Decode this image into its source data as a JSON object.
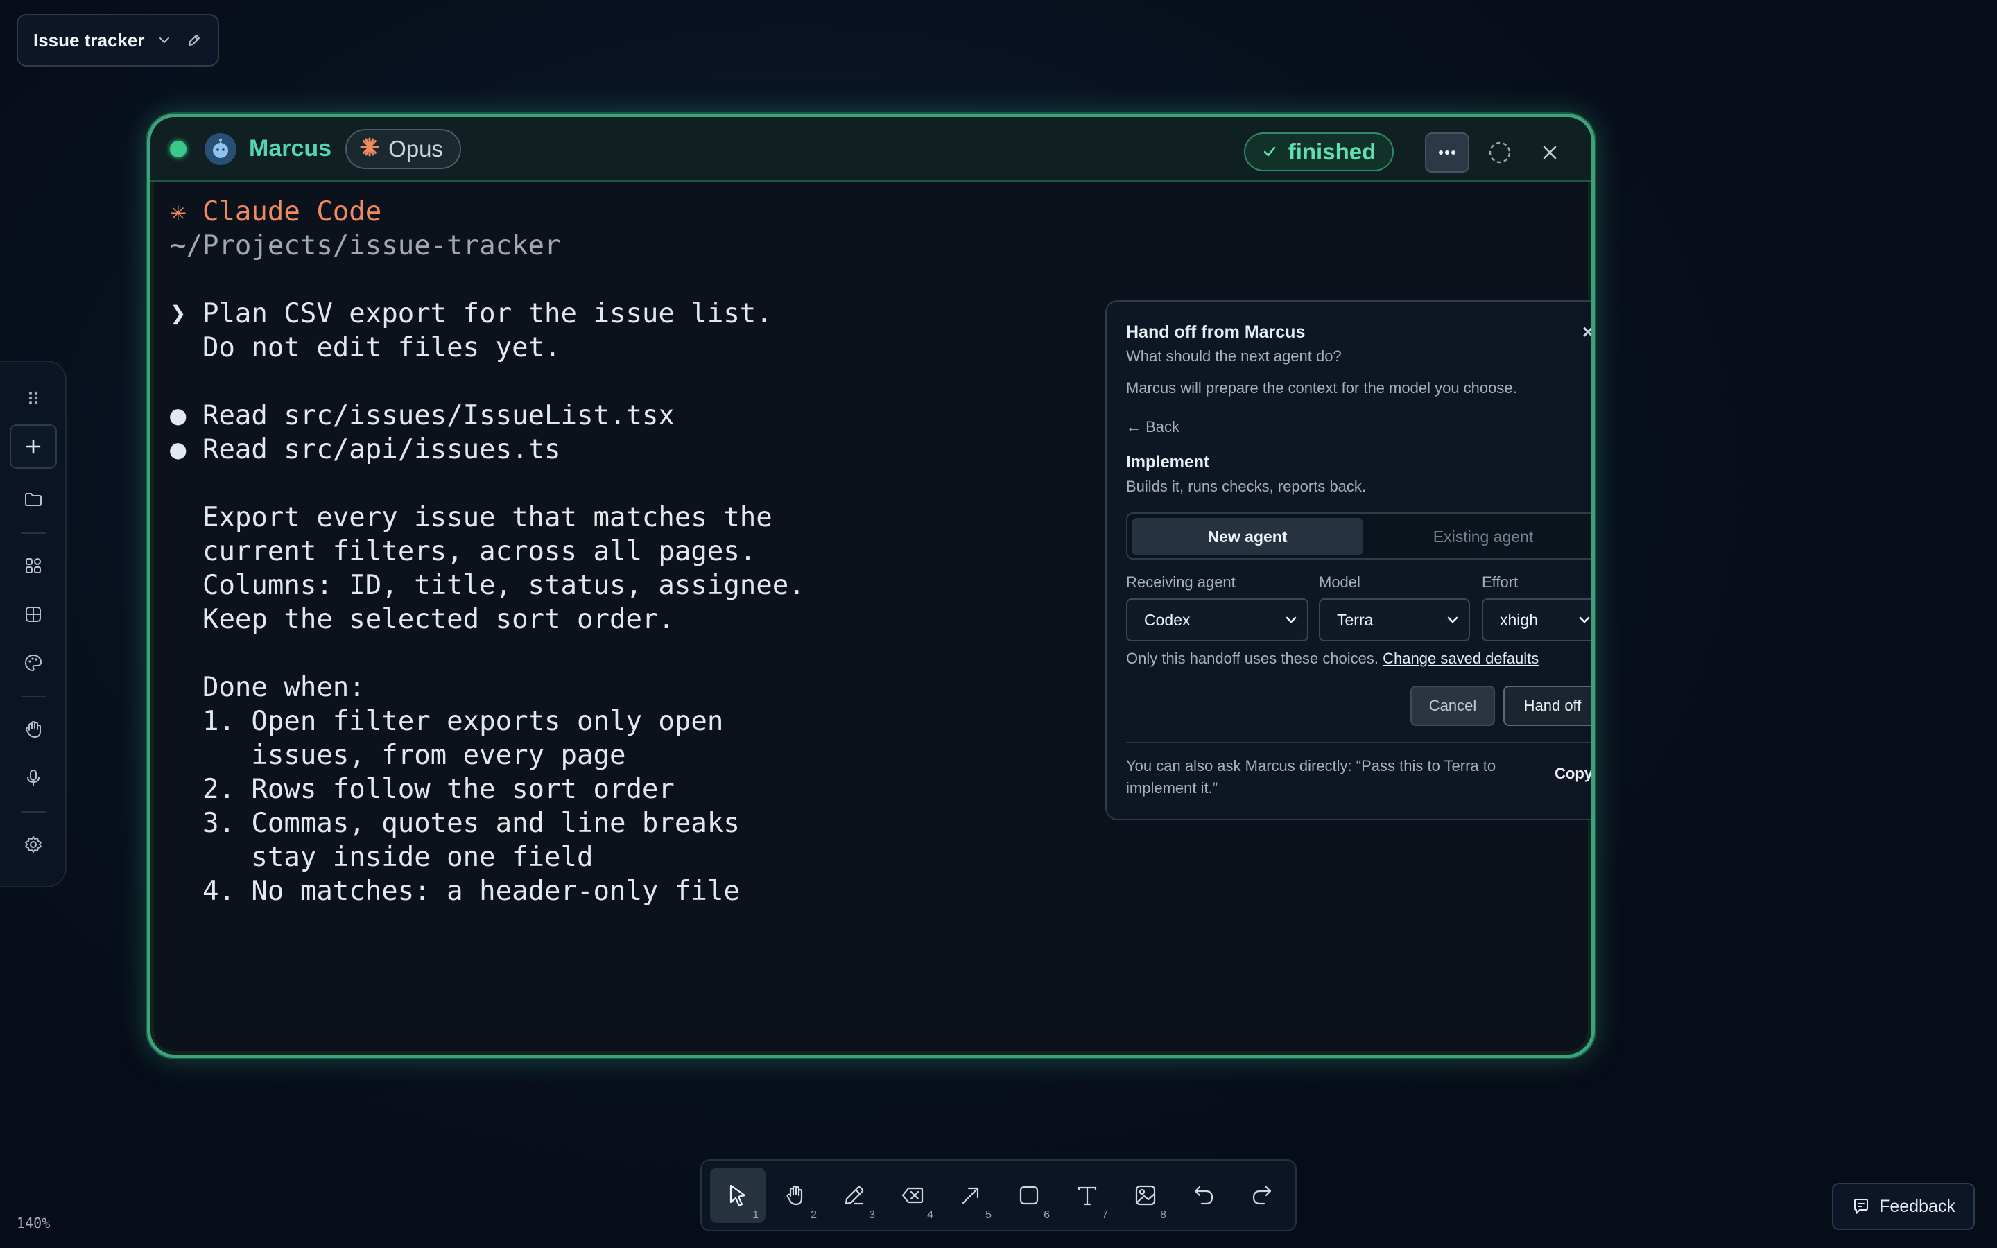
{
  "board": {
    "title": "Issue tracker",
    "zoom": "140%"
  },
  "left_toolbar": {
    "items": [
      "drag-handle",
      "add",
      "folder",
      "components",
      "grid",
      "palette",
      "hand",
      "microphone",
      "settings"
    ]
  },
  "agent": {
    "name": "Marcus",
    "model": "Opus",
    "status": "finished",
    "status_color": "#38c98b",
    "accent": "#3ca37d"
  },
  "terminal": {
    "lines": [
      {
        "text": "✳ Claude Code",
        "style": "cc"
      },
      {
        "text": "~/Projects/issue-tracker",
        "style": "path"
      },
      {
        "text": "",
        "style": ""
      },
      {
        "text": "❯ Plan CSV export for the issue list.",
        "style": ""
      },
      {
        "text": "  Do not edit files yet.",
        "style": ""
      },
      {
        "text": "",
        "style": ""
      },
      {
        "text": "● Read src/issues/IssueList.tsx",
        "style": ""
      },
      {
        "text": "● Read src/api/issues.ts",
        "style": ""
      },
      {
        "text": "",
        "style": ""
      },
      {
        "text": "  Export every issue that matches the",
        "style": ""
      },
      {
        "text": "  current filters, across all pages.",
        "style": ""
      },
      {
        "text": "  Columns: ID, title, status, assignee.",
        "style": ""
      },
      {
        "text": "  Keep the selected sort order.",
        "style": ""
      },
      {
        "text": "",
        "style": ""
      },
      {
        "text": "  Done when:",
        "style": ""
      },
      {
        "text": "  1. Open filter exports only open",
        "style": ""
      },
      {
        "text": "     issues, from every page",
        "style": ""
      },
      {
        "text": "  2. Rows follow the sort order",
        "style": ""
      },
      {
        "text": "  3. Commas, quotes and line breaks",
        "style": ""
      },
      {
        "text": "     stay inside one field",
        "style": ""
      },
      {
        "text": "  4. No matches: a header-only file",
        "style": ""
      }
    ]
  },
  "handoff": {
    "title": "Hand off from Marcus",
    "close": "×",
    "subtitle": "What should the next agent do?",
    "description": "Marcus will prepare the context for the model you choose.",
    "back": "← Back",
    "section_title": "Implement",
    "section_subtitle": "Builds it, runs checks, reports back.",
    "tabs": {
      "active": "New agent",
      "inactive": "Existing agent"
    },
    "fields": {
      "receiving_agent": {
        "label": "Receiving agent",
        "value": "Codex"
      },
      "model": {
        "label": "Model",
        "value": "Terra"
      },
      "effort": {
        "label": "Effort",
        "value": "xhigh"
      }
    },
    "note": "Only this handoff uses these choices.",
    "note_link": "Change saved defaults",
    "cancel": "Cancel",
    "submit": "Hand off",
    "tip": "You can also ask Marcus directly: “Pass this to Terra to implement it.”",
    "copy": "Copy"
  },
  "bottom_toolbar": {
    "tools": [
      {
        "name": "select",
        "num": "1"
      },
      {
        "name": "hand",
        "num": "2"
      },
      {
        "name": "pencil",
        "num": "3"
      },
      {
        "name": "eraser",
        "num": "4"
      },
      {
        "name": "arrow",
        "num": "5"
      },
      {
        "name": "rectangle",
        "num": "6"
      },
      {
        "name": "text",
        "num": "7"
      },
      {
        "name": "image",
        "num": "8"
      }
    ],
    "active": "select"
  },
  "feedback": {
    "label": "Feedback"
  }
}
